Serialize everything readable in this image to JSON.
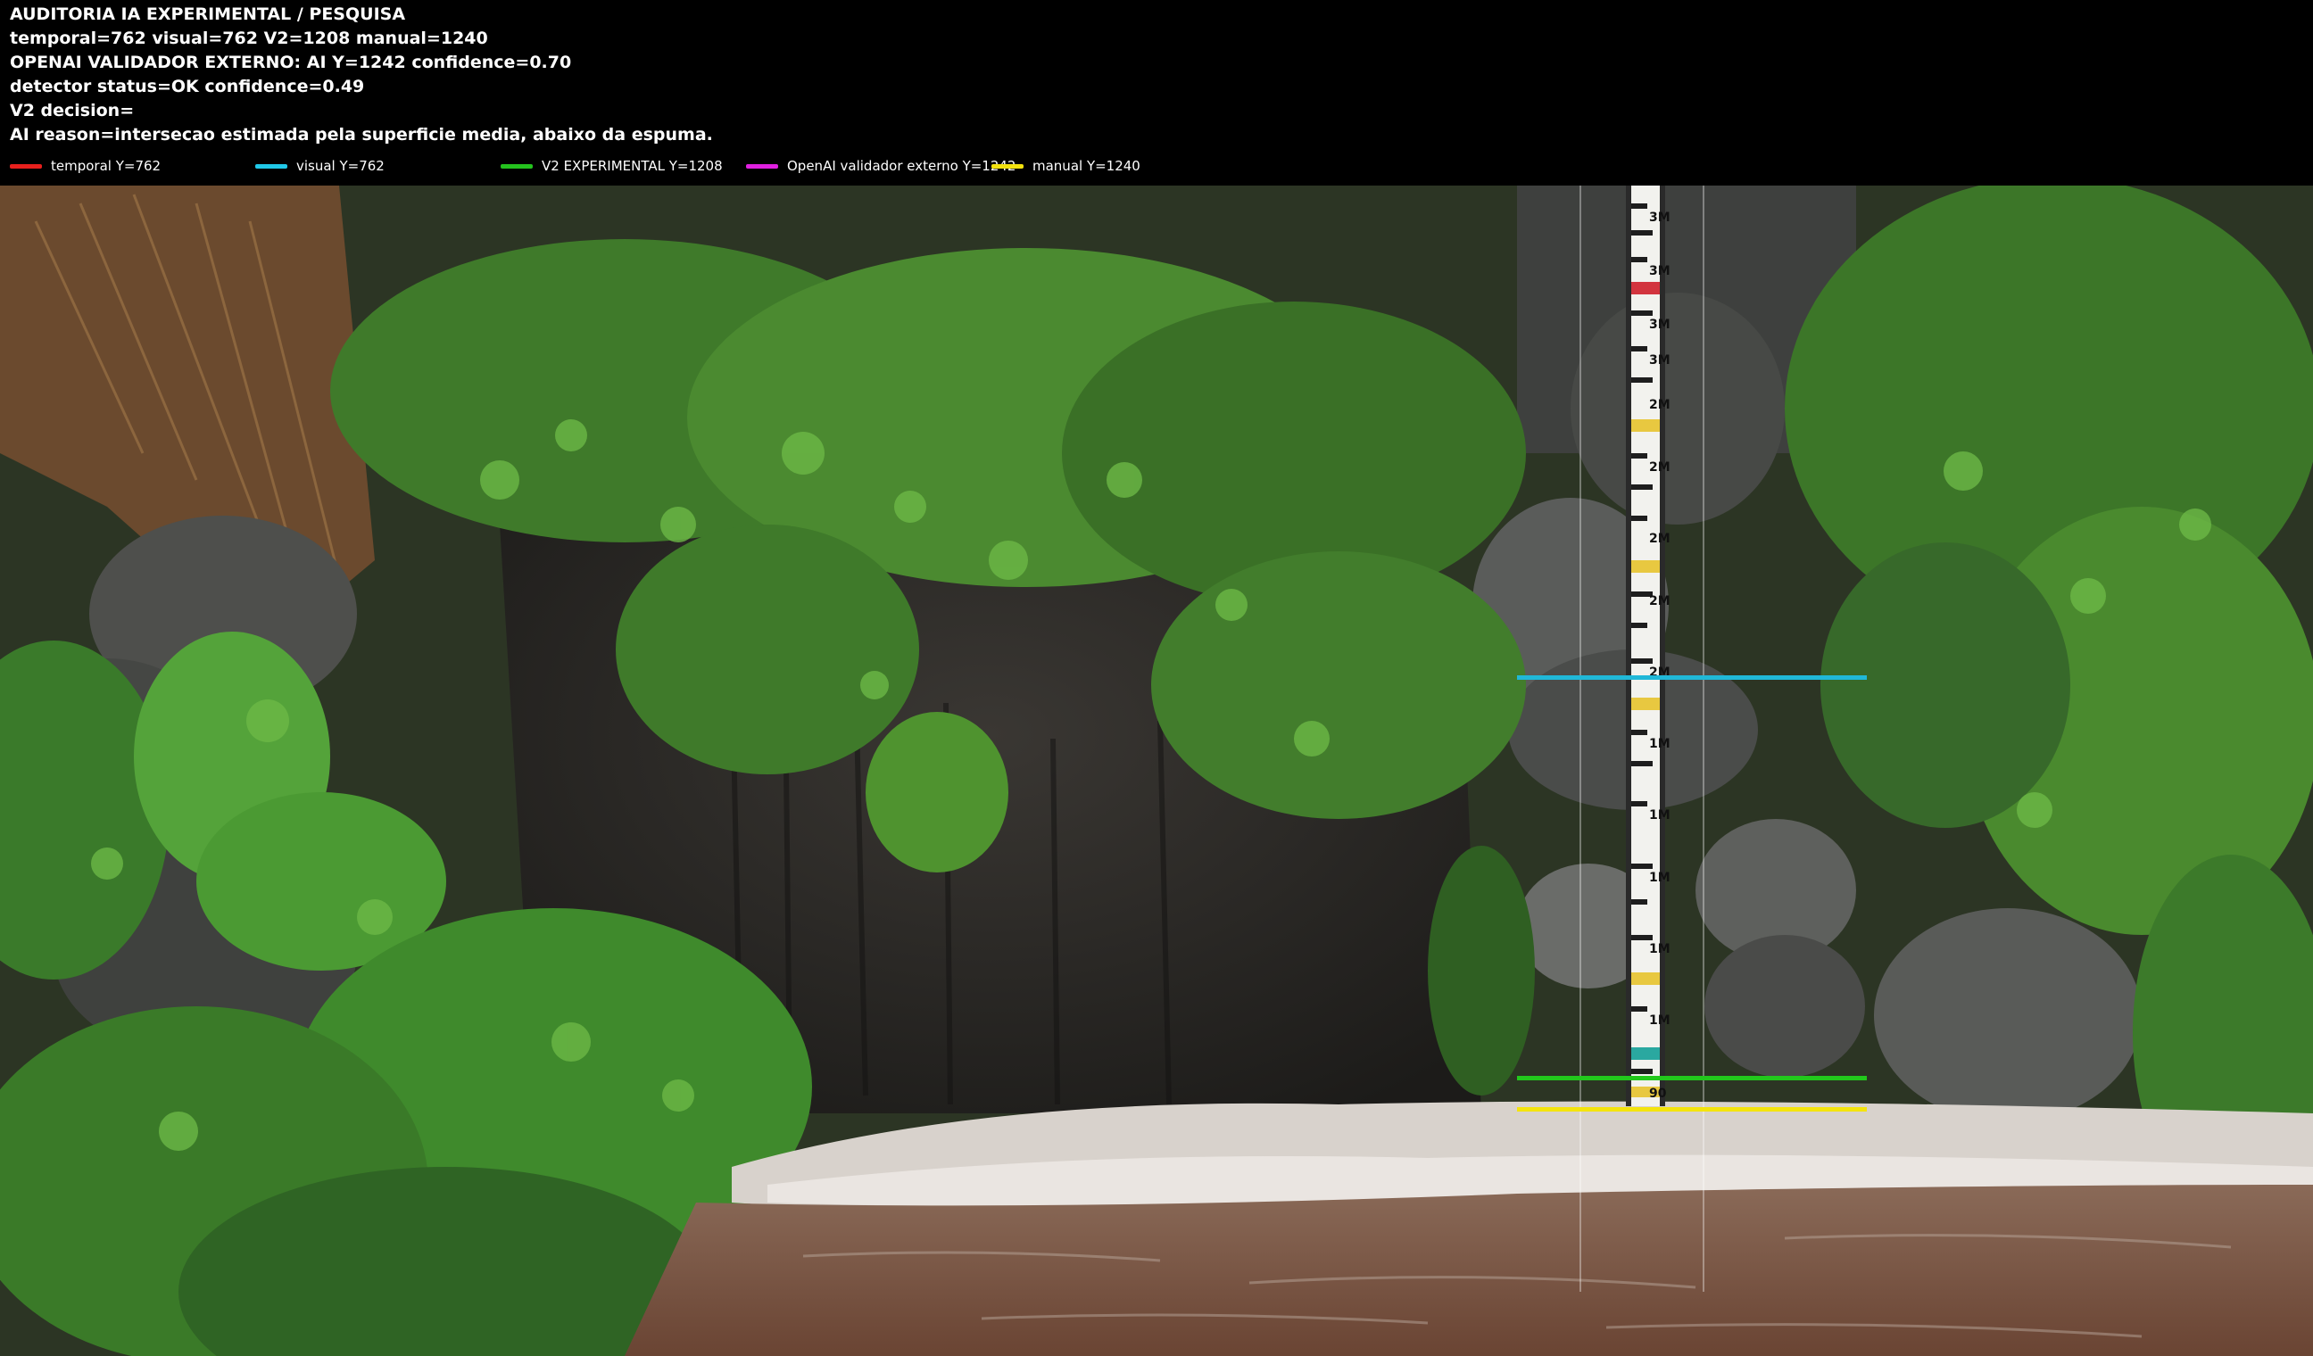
{
  "header": {
    "line1": "AUDITORIA IA  EXPERIMENTAL / PESQUISA",
    "line2": "temporal=762  visual=762  V2=1208  manual=1240",
    "line3": "OPENAI  VALIDADOR EXTERNO: AI Y=1242  confidence=0.70",
    "line4": "detector status=OK confidence=0.49",
    "line5": "V2 decision=",
    "line6": "AI reason=intersecao estimada pela superficie media, abaixo da espuma."
  },
  "legend": [
    {
      "label": "temporal Y=762",
      "color": "#e8201d"
    },
    {
      "label": "visual Y=762",
      "color": "#20c8e8"
    },
    {
      "label": "V2 EXPERIMENTAL Y=1208",
      "color": "#24c21e"
    },
    {
      "label": "OpenAI validador externo Y=1242",
      "color": "#e020e0"
    },
    {
      "label": "manual Y=1240",
      "color": "#f2e10e"
    }
  ],
  "lines": {
    "visual_color": "#20b8d8",
    "v2_color": "#22c81c",
    "manual_color": "#f4e40c"
  },
  "gauge": {
    "labels": [
      "3M",
      "3M",
      "3M",
      "3M",
      "2M",
      "2M",
      "2M",
      "2M",
      "2M",
      "1M",
      "1M",
      "1M",
      "1M",
      "1M",
      "90"
    ],
    "accent_red": "#d2343e",
    "accent_yellow": "#e8c840",
    "accent_teal": "#2aa8a0"
  }
}
